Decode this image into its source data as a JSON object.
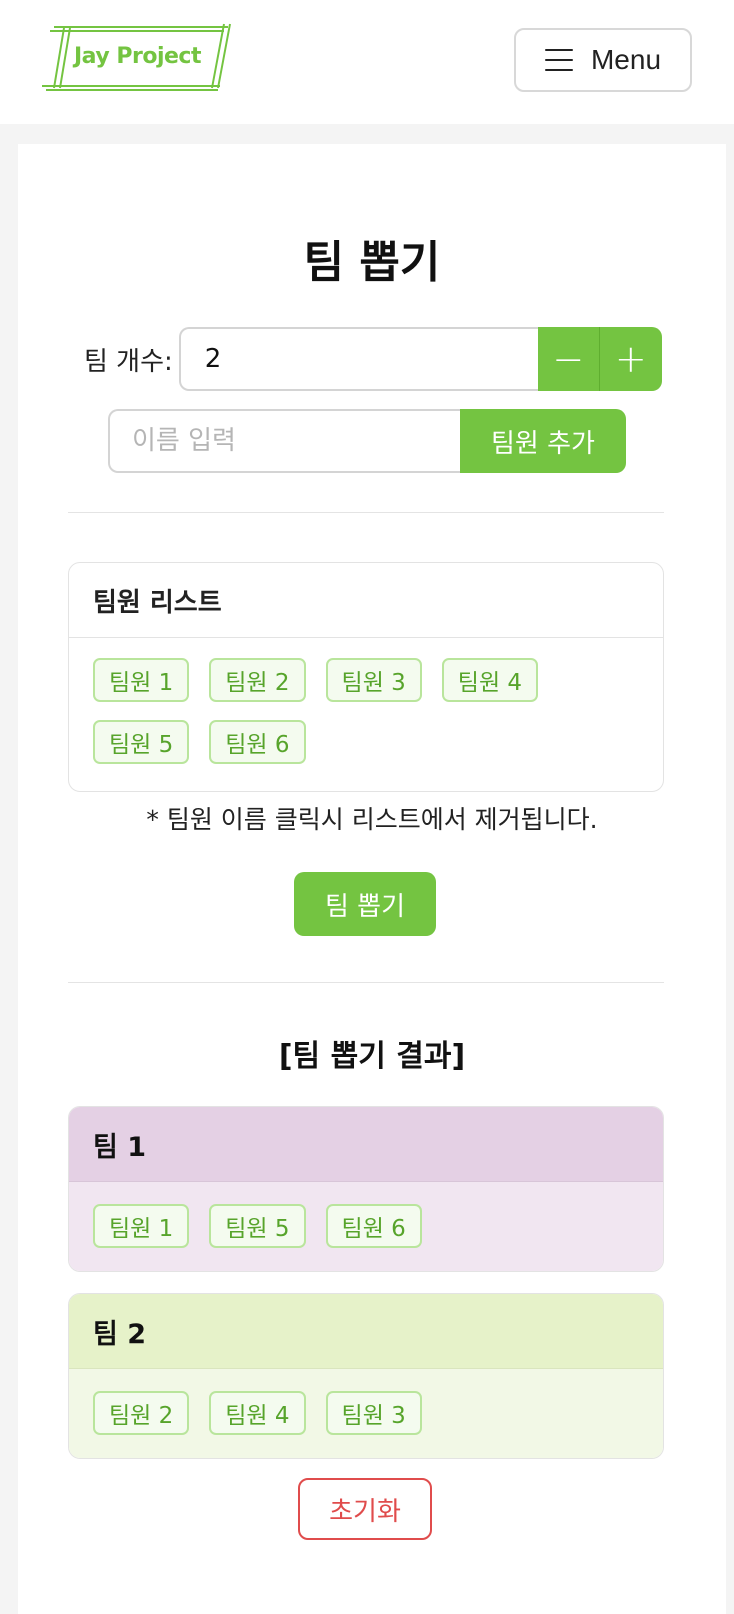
{
  "header": {
    "logo_text": "Jay Project",
    "menu_label": "Menu"
  },
  "main": {
    "title": "팀 뽑기",
    "team_count_label": "팀 개수:",
    "team_count_value": "2",
    "minus_symbol": "−",
    "plus_symbol": "+",
    "name_placeholder": "이름 입력",
    "add_member_label": "팀원 추가",
    "member_list": {
      "title": "팀원 리스트",
      "members": [
        "팀원 1",
        "팀원 2",
        "팀원 3",
        "팀원 4",
        "팀원 5",
        "팀원 6"
      ]
    },
    "note": "* 팀원 이름 클릭시 리스트에서 제거됩니다.",
    "pick_button_label": "팀 뽑기",
    "result_title": "[팀 뽑기 결과]",
    "teams": [
      {
        "name": "팀 1",
        "members": [
          "팀원 1",
          "팀원 5",
          "팀원 6"
        ]
      },
      {
        "name": "팀 2",
        "members": [
          "팀원 2",
          "팀원 4",
          "팀원 3"
        ]
      }
    ],
    "reset_label": "초기화"
  },
  "colors": {
    "accent": "#74c441",
    "danger": "#e04c4c",
    "team1": "#e4d0e4",
    "team2": "#e6f2c9"
  }
}
